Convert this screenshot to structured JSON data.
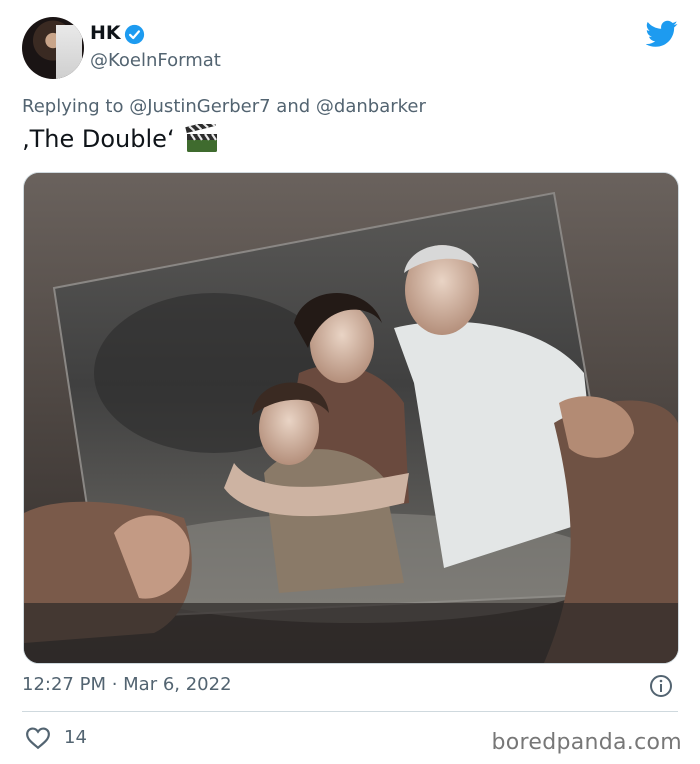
{
  "author": {
    "name": "HK",
    "handle": "@KoelnFormat",
    "verified": true
  },
  "reply": {
    "prefix": "Replying to",
    "users": [
      "@JustinGerber7",
      "@danbarker"
    ],
    "joiner": "and"
  },
  "tweet": {
    "text": "‚The Double‘",
    "emoji": "clapper-board-icon"
  },
  "meta": {
    "time": "12:27 PM · Mar 6, 2022"
  },
  "actions": {
    "like_count": "14"
  },
  "watermark": "boredpanda.com",
  "colors": {
    "twitter_blue": "#1d9bf0",
    "secondary_text": "#536471"
  }
}
